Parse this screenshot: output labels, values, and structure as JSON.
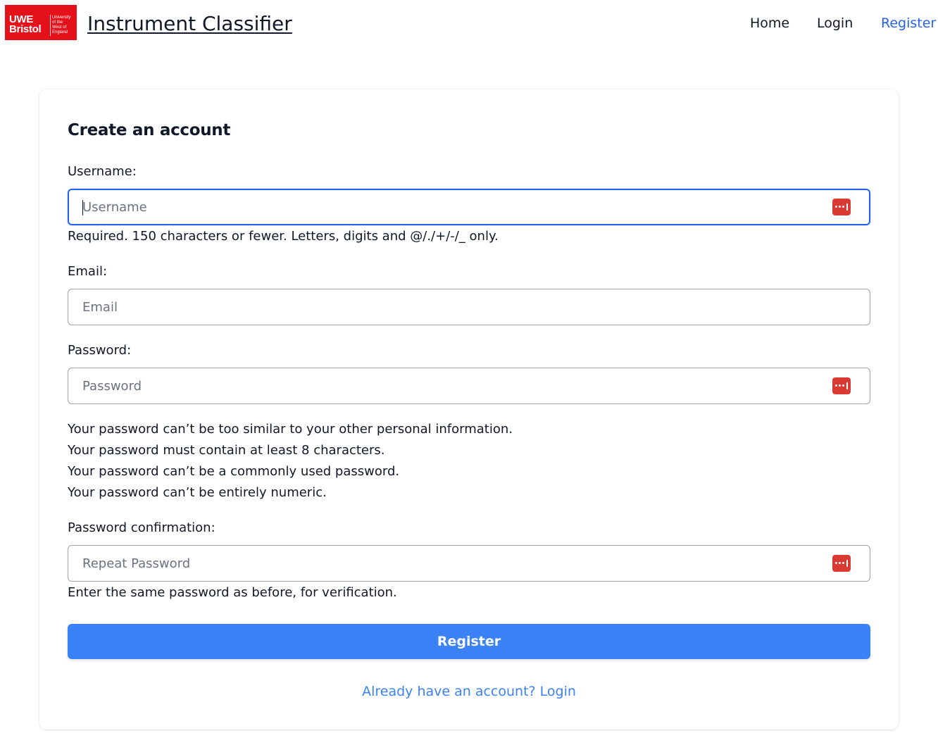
{
  "header": {
    "logo": {
      "line1": "UWE",
      "line2": "Bristol",
      "small_text": "University\nof the\nWest of\nEngland"
    },
    "site_title": "Instrument Classifier",
    "nav": [
      {
        "label": "Home",
        "active": false
      },
      {
        "label": "Login",
        "active": false
      },
      {
        "label": "Register",
        "active": true
      }
    ]
  },
  "form": {
    "title": "Create an account",
    "username": {
      "label": "Username:",
      "placeholder": "Username",
      "value": "",
      "help": "Required. 150 characters or fewer. Letters, digits and @/./+/-/_ only."
    },
    "email": {
      "label": "Email:",
      "placeholder": "Email",
      "value": ""
    },
    "password": {
      "label": "Password:",
      "placeholder": "Password",
      "value": "",
      "help": [
        "Your password can’t be too similar to your other personal information.",
        "Your password must contain at least 8 characters.",
        "Your password can’t be a commonly used password.",
        "Your password can’t be entirely numeric."
      ]
    },
    "password_confirmation": {
      "label": "Password confirmation:",
      "placeholder": "Repeat Password",
      "value": "",
      "help": "Enter the same password as before, for verification."
    },
    "submit_label": "Register",
    "login_link": "Already have an account? Login"
  },
  "colors": {
    "brand_red": "#e4101a",
    "primary_blue": "#3b82f6",
    "active_link": "#2563eb",
    "password_manager_icon": "#d93a32"
  },
  "icons": {
    "password_manager": "password-manager-icon"
  }
}
